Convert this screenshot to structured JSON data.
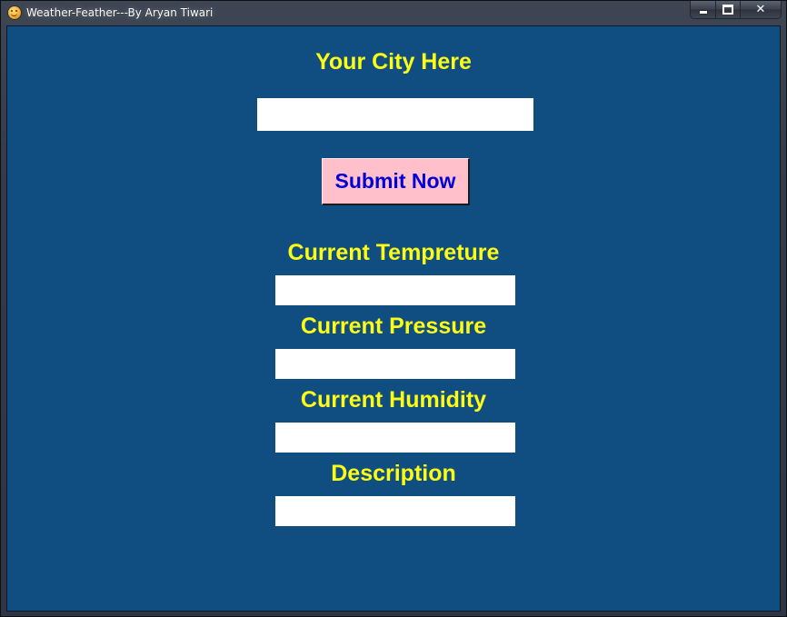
{
  "window": {
    "title": "Weather-Feather---By Aryan Tiwari",
    "icon": "smiley-app-icon",
    "controls": {
      "minimize": "minimize-icon",
      "maximize": "maximize-icon",
      "close": "close-icon"
    }
  },
  "form": {
    "city_label": "Your City Here",
    "city_input_value": "",
    "submit_label": "Submit Now",
    "temperature_label": "Current Tempreture",
    "temperature_value": "",
    "pressure_label": "Current Pressure",
    "pressure_value": "",
    "humidity_label": "Current Humidity",
    "humidity_value": "",
    "description_label": "Description",
    "description_value": ""
  },
  "colors": {
    "background": "#104e82",
    "label_text": "#fcfc14",
    "button_bg": "#ffc0cb",
    "button_text": "#0000d6",
    "field_bg": "#ffffff"
  }
}
